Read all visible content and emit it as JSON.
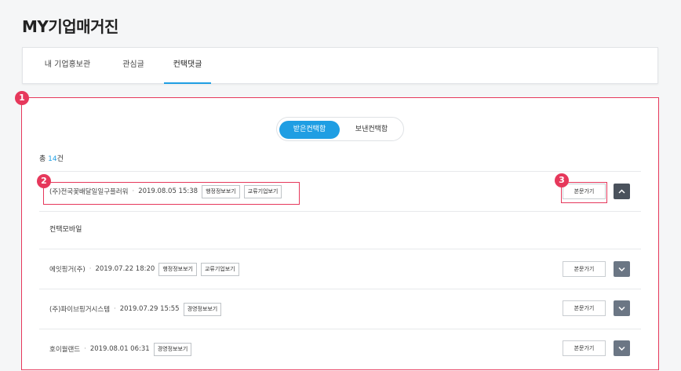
{
  "page": {
    "title": "MY기업매거진"
  },
  "tabs": [
    {
      "label": "내 기업홍보관",
      "active": false
    },
    {
      "label": "관심글",
      "active": false
    },
    {
      "label": "컨택댓글",
      "active": true
    }
  ],
  "toggle": {
    "received": "받은컨택함",
    "sent": "보낸컨택함",
    "selected": "received"
  },
  "count": {
    "prefix": "총",
    "number": "14",
    "suffix": "건"
  },
  "annotations": {
    "badge1": "1",
    "badge2": "2",
    "badge3": "3"
  },
  "rows": [
    {
      "company": "(주)전국꽃배달일일구플러워",
      "date": "2019.08.05 15:38",
      "buttons": [
        "행정정보보기",
        "교류기업보기"
      ],
      "view_label": "본문가기",
      "expanded": true,
      "content": "컨택모바일"
    },
    {
      "company": "에잇핑거(주)",
      "date": "2019.07.22 18:20",
      "buttons": [
        "행정정보보기",
        "교류기업보기"
      ],
      "view_label": "본문가기",
      "expanded": false
    },
    {
      "company": "(주)파이브핑거시스템",
      "date": "2019.07.29 15:55",
      "buttons": [
        "경영정보보기"
      ],
      "view_label": "본문가기",
      "expanded": false
    },
    {
      "company": "호이월랜드",
      "date": "2019.08.01 06:31",
      "buttons": [
        "경영정보보기"
      ],
      "view_label": "본문가기",
      "expanded": false
    }
  ],
  "colors": {
    "accent": "#1f9ee3",
    "annotation": "#e6385b",
    "chevron_bg": "#6b7684"
  }
}
